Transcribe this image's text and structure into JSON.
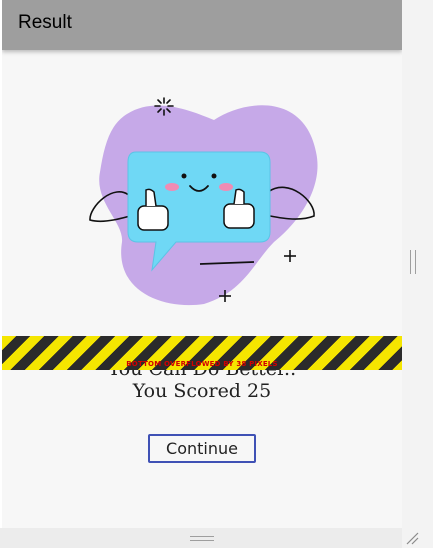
{
  "appbar": {
    "title": "Result"
  },
  "illustration": {
    "name": "thumbs-up-chat-bubble"
  },
  "result": {
    "line1": "You Can Do Better..",
    "line2": "You Scored 25"
  },
  "overflow_warning": "BOTTOM OVERFLOWED BY 38 PIXELS",
  "continue_button": {
    "label": "Continue"
  },
  "colors": {
    "appbar": "#9e9e9e",
    "button_border": "#3f51b5",
    "blob": "#c6a9e8",
    "bubble": "#6fd8f5",
    "warning_yellow": "#f5e600",
    "warning_text": "#d20000"
  }
}
